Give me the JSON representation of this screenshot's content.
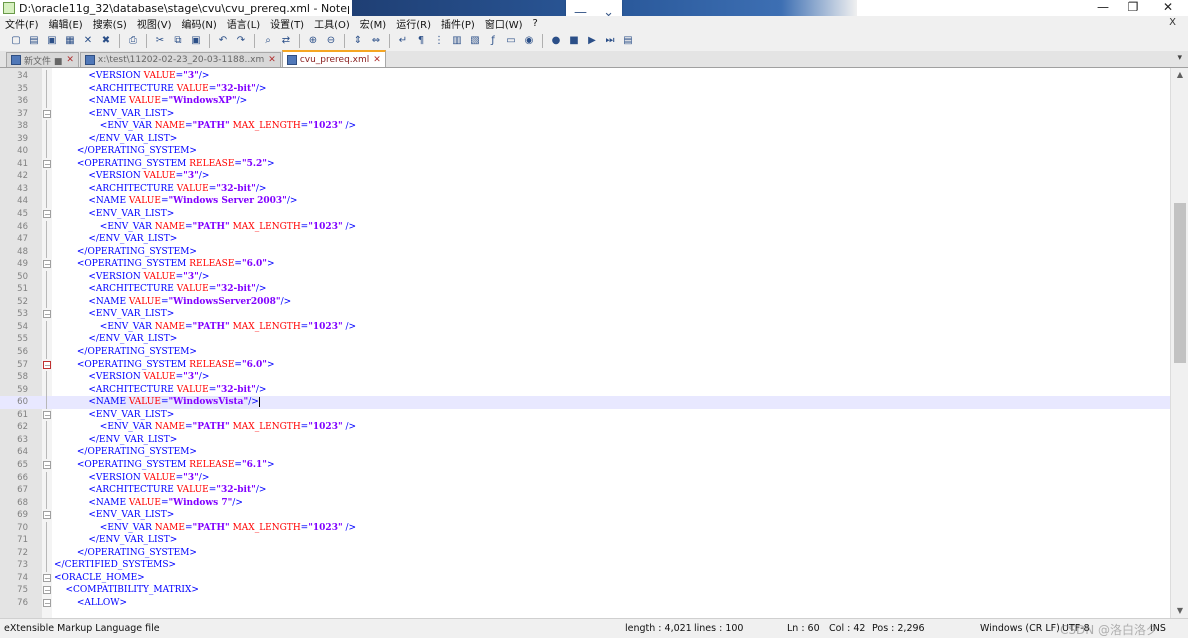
{
  "window": {
    "title": "D:\\oracle11g_32\\database\\stage\\cvu\\cvu_prereq.xml - Notepad++ [Admi",
    "minimize_glyph": "—",
    "maximize_glyph": "❐",
    "close_glyph": "✕",
    "overlay_minimize": "—",
    "overlay_chevron": "⌄"
  },
  "menu": {
    "items": [
      "文件(F)",
      "编辑(E)",
      "搜索(S)",
      "视图(V)",
      "编码(N)",
      "语言(L)",
      "设置(T)",
      "工具(O)",
      "宏(M)",
      "运行(R)",
      "插件(P)",
      "窗口(W)",
      "?"
    ],
    "close_x": "X"
  },
  "toolbar": {
    "icons": [
      "new-file-icon",
      "open-file-icon",
      "save-icon",
      "save-all-icon",
      "close-icon",
      "close-all-icon",
      "print-icon",
      "cut-icon",
      "copy-icon",
      "paste-icon",
      "undo-icon",
      "redo-icon",
      "find-icon",
      "replace-icon",
      "zoom-in-icon",
      "zoom-out-icon",
      "sync-v-icon",
      "sync-h-icon",
      "word-wrap-icon",
      "all-chars-icon",
      "indent-guide-icon",
      "udl-icon",
      "doc-map-icon",
      "function-list-icon",
      "folder-workspace-icon",
      "monitor-icon",
      "record-macro-icon",
      "stop-macro-icon",
      "play-macro-icon",
      "run-macro-multiple-icon",
      "save-macro-icon"
    ],
    "glyphs": [
      "▢",
      "▤",
      "▣",
      "▦",
      "✕",
      "✖",
      "⎙",
      "✂",
      "⧉",
      "▣",
      "↶",
      "↷",
      "⌕",
      "⇄",
      "⊕",
      "⊖",
      "⇕",
      "⇔",
      "↵",
      "¶",
      "⋮",
      "▥",
      "▧",
      "ƒ",
      "▭",
      "◉",
      "●",
      "■",
      "▶",
      "⏭",
      "▤"
    ]
  },
  "tabs": [
    {
      "label": "新文件 ■",
      "active": false
    },
    {
      "label": "x:\\test\\11202-02-23_20-03-1188..xm",
      "active": false
    },
    {
      "label": "cvu_prereq.xml",
      "active": true
    }
  ],
  "tab_close_glyph": "✕",
  "tab_list_glyph": "▾",
  "editor": {
    "current_line": 60,
    "lines": [
      {
        "n": "34",
        "fold": "line",
        "tokens": [
          [
            "i",
            "            "
          ],
          [
            "tag",
            "<VERSION "
          ],
          [
            "attr",
            "VALUE"
          ],
          [
            "tag",
            "="
          ],
          [
            "val",
            "\"3\""
          ],
          [
            "tag",
            "/>"
          ]
        ]
      },
      {
        "n": "35",
        "fold": "line",
        "tokens": [
          [
            "i",
            "            "
          ],
          [
            "tag",
            "<ARCHITECTURE "
          ],
          [
            "attr",
            "VALUE"
          ],
          [
            "tag",
            "="
          ],
          [
            "val",
            "\"32-bit\""
          ],
          [
            "tag",
            "/>"
          ]
        ]
      },
      {
        "n": "36",
        "fold": "line",
        "tokens": [
          [
            "i",
            "            "
          ],
          [
            "tag",
            "<NAME "
          ],
          [
            "attr",
            "VALUE"
          ],
          [
            "tag",
            "="
          ],
          [
            "val",
            "\"WindowsXP\""
          ],
          [
            "tag",
            "/>"
          ]
        ]
      },
      {
        "n": "37",
        "fold": "box",
        "tokens": [
          [
            "i",
            "            "
          ],
          [
            "tag",
            "<ENV_VAR_LIST>"
          ]
        ]
      },
      {
        "n": "38",
        "fold": "line",
        "tokens": [
          [
            "i",
            "                "
          ],
          [
            "tag",
            "<ENV_VAR "
          ],
          [
            "attr",
            "NAME"
          ],
          [
            "tag",
            "="
          ],
          [
            "val",
            "\"PATH\""
          ],
          [
            "tag",
            " "
          ],
          [
            "attr",
            "MAX_LENGTH"
          ],
          [
            "tag",
            "="
          ],
          [
            "val",
            "\"1023\""
          ],
          [
            "tag",
            " />"
          ]
        ]
      },
      {
        "n": "39",
        "fold": "line",
        "tokens": [
          [
            "i",
            "            "
          ],
          [
            "tag",
            "</ENV_VAR_LIST>"
          ]
        ]
      },
      {
        "n": "40",
        "fold": "line",
        "tokens": [
          [
            "i",
            "        "
          ],
          [
            "tag",
            "</OPERATING_SYSTEM>"
          ]
        ]
      },
      {
        "n": "41",
        "fold": "box",
        "tokens": [
          [
            "i",
            "        "
          ],
          [
            "tag",
            "<OPERATING_SYSTEM "
          ],
          [
            "attr",
            "RELEASE"
          ],
          [
            "tag",
            "="
          ],
          [
            "val",
            "\"5.2\""
          ],
          [
            "tag",
            ">"
          ]
        ]
      },
      {
        "n": "42",
        "fold": "line",
        "tokens": [
          [
            "i",
            "            "
          ],
          [
            "tag",
            "<VERSION "
          ],
          [
            "attr",
            "VALUE"
          ],
          [
            "tag",
            "="
          ],
          [
            "val",
            "\"3\""
          ],
          [
            "tag",
            "/>"
          ]
        ]
      },
      {
        "n": "43",
        "fold": "line",
        "tokens": [
          [
            "i",
            "            "
          ],
          [
            "tag",
            "<ARCHITECTURE "
          ],
          [
            "attr",
            "VALUE"
          ],
          [
            "tag",
            "="
          ],
          [
            "val",
            "\"32-bit\""
          ],
          [
            "tag",
            "/>"
          ]
        ]
      },
      {
        "n": "44",
        "fold": "line",
        "tokens": [
          [
            "i",
            "            "
          ],
          [
            "tag",
            "<NAME "
          ],
          [
            "attr",
            "VALUE"
          ],
          [
            "tag",
            "="
          ],
          [
            "val",
            "\"Windows Server 2003\""
          ],
          [
            "tag",
            "/>"
          ]
        ]
      },
      {
        "n": "45",
        "fold": "box",
        "tokens": [
          [
            "i",
            "            "
          ],
          [
            "tag",
            "<ENV_VAR_LIST>"
          ]
        ]
      },
      {
        "n": "46",
        "fold": "line",
        "tokens": [
          [
            "i",
            "                "
          ],
          [
            "tag",
            "<ENV_VAR "
          ],
          [
            "attr",
            "NAME"
          ],
          [
            "tag",
            "="
          ],
          [
            "val",
            "\"PATH\""
          ],
          [
            "tag",
            " "
          ],
          [
            "attr",
            "MAX_LENGTH"
          ],
          [
            "tag",
            "="
          ],
          [
            "val",
            "\"1023\""
          ],
          [
            "tag",
            " />"
          ]
        ]
      },
      {
        "n": "47",
        "fold": "line",
        "tokens": [
          [
            "i",
            "            "
          ],
          [
            "tag",
            "</ENV_VAR_LIST>"
          ]
        ]
      },
      {
        "n": "48",
        "fold": "line",
        "tokens": [
          [
            "i",
            "        "
          ],
          [
            "tag",
            "</OPERATING_SYSTEM>"
          ]
        ]
      },
      {
        "n": "49",
        "fold": "box",
        "tokens": [
          [
            "i",
            "        "
          ],
          [
            "tag",
            "<OPERATING_SYSTEM "
          ],
          [
            "attr",
            "RELEASE"
          ],
          [
            "tag",
            "="
          ],
          [
            "val",
            "\"6.0\""
          ],
          [
            "tag",
            ">"
          ]
        ]
      },
      {
        "n": "50",
        "fold": "line",
        "tokens": [
          [
            "i",
            "            "
          ],
          [
            "tag",
            "<VERSION "
          ],
          [
            "attr",
            "VALUE"
          ],
          [
            "tag",
            "="
          ],
          [
            "val",
            "\"3\""
          ],
          [
            "tag",
            "/>"
          ]
        ]
      },
      {
        "n": "51",
        "fold": "line",
        "tokens": [
          [
            "i",
            "            "
          ],
          [
            "tag",
            "<ARCHITECTURE "
          ],
          [
            "attr",
            "VALUE"
          ],
          [
            "tag",
            "="
          ],
          [
            "val",
            "\"32-bit\""
          ],
          [
            "tag",
            "/>"
          ]
        ]
      },
      {
        "n": "52",
        "fold": "line",
        "tokens": [
          [
            "i",
            "            "
          ],
          [
            "tag",
            "<NAME "
          ],
          [
            "attr",
            "VALUE"
          ],
          [
            "tag",
            "="
          ],
          [
            "val",
            "\"WindowsServer2008\""
          ],
          [
            "tag",
            "/>"
          ]
        ]
      },
      {
        "n": "53",
        "fold": "box",
        "tokens": [
          [
            "i",
            "            "
          ],
          [
            "tag",
            "<ENV_VAR_LIST>"
          ]
        ]
      },
      {
        "n": "54",
        "fold": "line",
        "tokens": [
          [
            "i",
            "                "
          ],
          [
            "tag",
            "<ENV_VAR "
          ],
          [
            "attr",
            "NAME"
          ],
          [
            "tag",
            "="
          ],
          [
            "val",
            "\"PATH\""
          ],
          [
            "tag",
            " "
          ],
          [
            "attr",
            "MAX_LENGTH"
          ],
          [
            "tag",
            "="
          ],
          [
            "val",
            "\"1023\""
          ],
          [
            "tag",
            " />"
          ]
        ]
      },
      {
        "n": "55",
        "fold": "line",
        "tokens": [
          [
            "i",
            "            "
          ],
          [
            "tag",
            "</ENV_VAR_LIST>"
          ]
        ]
      },
      {
        "n": "56",
        "fold": "line",
        "tokens": [
          [
            "i",
            "        "
          ],
          [
            "tag",
            "</OPERATING_SYSTEM>"
          ]
        ]
      },
      {
        "n": "57",
        "fold": "boxred",
        "tokens": [
          [
            "i",
            "        "
          ],
          [
            "tag",
            "<OPERATING_SYSTEM "
          ],
          [
            "attr",
            "RELEASE"
          ],
          [
            "tag",
            "="
          ],
          [
            "val",
            "\"6.0\""
          ],
          [
            "tag",
            ">"
          ]
        ]
      },
      {
        "n": "58",
        "fold": "line",
        "tokens": [
          [
            "i",
            "            "
          ],
          [
            "tag",
            "<VERSION "
          ],
          [
            "attr",
            "VALUE"
          ],
          [
            "tag",
            "="
          ],
          [
            "val",
            "\"3\""
          ],
          [
            "tag",
            "/>"
          ]
        ]
      },
      {
        "n": "59",
        "fold": "line",
        "tokens": [
          [
            "i",
            "            "
          ],
          [
            "tag",
            "<ARCHITECTURE "
          ],
          [
            "attr",
            "VALUE"
          ],
          [
            "tag",
            "="
          ],
          [
            "val",
            "\"32-bit\""
          ],
          [
            "tag",
            "/>"
          ]
        ]
      },
      {
        "n": "60",
        "fold": "line",
        "tokens": [
          [
            "i",
            "            "
          ],
          [
            "tag",
            "<NAME "
          ],
          [
            "attr",
            "VALUE"
          ],
          [
            "tag",
            "="
          ],
          [
            "val",
            "\"WindowsVista\""
          ],
          [
            "tag",
            "/>"
          ]
        ]
      },
      {
        "n": "61",
        "fold": "box",
        "tokens": [
          [
            "i",
            "            "
          ],
          [
            "tag",
            "<ENV_VAR_LIST>"
          ]
        ]
      },
      {
        "n": "62",
        "fold": "line",
        "tokens": [
          [
            "i",
            "                "
          ],
          [
            "tag",
            "<ENV_VAR "
          ],
          [
            "attr",
            "NAME"
          ],
          [
            "tag",
            "="
          ],
          [
            "val",
            "\"PATH\""
          ],
          [
            "tag",
            " "
          ],
          [
            "attr",
            "MAX_LENGTH"
          ],
          [
            "tag",
            "="
          ],
          [
            "val",
            "\"1023\""
          ],
          [
            "tag",
            " />"
          ]
        ]
      },
      {
        "n": "63",
        "fold": "line",
        "tokens": [
          [
            "i",
            "            "
          ],
          [
            "tag",
            "</ENV_VAR_LIST>"
          ]
        ]
      },
      {
        "n": "64",
        "fold": "line",
        "tokens": [
          [
            "i",
            "        "
          ],
          [
            "tag",
            "</OPERATING_SYSTEM>"
          ]
        ]
      },
      {
        "n": "65",
        "fold": "box",
        "tokens": [
          [
            "i",
            "        "
          ],
          [
            "tag",
            "<OPERATING_SYSTEM "
          ],
          [
            "attr",
            "RELEASE"
          ],
          [
            "tag",
            "="
          ],
          [
            "val",
            "\"6.1\""
          ],
          [
            "tag",
            ">"
          ]
        ]
      },
      {
        "n": "66",
        "fold": "line",
        "tokens": [
          [
            "i",
            "            "
          ],
          [
            "tag",
            "<VERSION "
          ],
          [
            "attr",
            "VALUE"
          ],
          [
            "tag",
            "="
          ],
          [
            "val",
            "\"3\""
          ],
          [
            "tag",
            "/>"
          ]
        ]
      },
      {
        "n": "67",
        "fold": "line",
        "tokens": [
          [
            "i",
            "            "
          ],
          [
            "tag",
            "<ARCHITECTURE "
          ],
          [
            "attr",
            "VALUE"
          ],
          [
            "tag",
            "="
          ],
          [
            "val",
            "\"32-bit\""
          ],
          [
            "tag",
            "/>"
          ]
        ]
      },
      {
        "n": "68",
        "fold": "line",
        "tokens": [
          [
            "i",
            "            "
          ],
          [
            "tag",
            "<NAME "
          ],
          [
            "attr",
            "VALUE"
          ],
          [
            "tag",
            "="
          ],
          [
            "val",
            "\"Windows 7\""
          ],
          [
            "tag",
            "/>"
          ]
        ]
      },
      {
        "n": "69",
        "fold": "box",
        "tokens": [
          [
            "i",
            "            "
          ],
          [
            "tag",
            "<ENV_VAR_LIST>"
          ]
        ]
      },
      {
        "n": "70",
        "fold": "line",
        "tokens": [
          [
            "i",
            "                "
          ],
          [
            "tag",
            "<ENV_VAR "
          ],
          [
            "attr",
            "NAME"
          ],
          [
            "tag",
            "="
          ],
          [
            "val",
            "\"PATH\""
          ],
          [
            "tag",
            " "
          ],
          [
            "attr",
            "MAX_LENGTH"
          ],
          [
            "tag",
            "="
          ],
          [
            "val",
            "\"1023\""
          ],
          [
            "tag",
            " />"
          ]
        ]
      },
      {
        "n": "71",
        "fold": "line",
        "tokens": [
          [
            "i",
            "            "
          ],
          [
            "tag",
            "</ENV_VAR_LIST>"
          ]
        ]
      },
      {
        "n": "72",
        "fold": "line",
        "tokens": [
          [
            "i",
            "        "
          ],
          [
            "tag",
            "</OPERATING_SYSTEM>"
          ]
        ]
      },
      {
        "n": "73",
        "fold": "line",
        "tokens": [
          [
            "i",
            ""
          ],
          [
            "tag",
            "</CERTIFIED_SYSTEMS>"
          ]
        ]
      },
      {
        "n": "74",
        "fold": "box",
        "tokens": [
          [
            "i",
            ""
          ],
          [
            "tag",
            "<ORACLE_HOME>"
          ]
        ]
      },
      {
        "n": "75",
        "fold": "box",
        "tokens": [
          [
            "i",
            "    "
          ],
          [
            "tag",
            "<COMPATIBILITY_MATRIX>"
          ]
        ]
      },
      {
        "n": "76",
        "fold": "box",
        "tokens": [
          [
            "i",
            "        "
          ],
          [
            "tag",
            "<ALLOW>"
          ]
        ]
      }
    ]
  },
  "scrollbar": {
    "up_glyph": "▲",
    "down_glyph": "▼"
  },
  "status": {
    "file_type": "eXtensible Markup Language file",
    "length": "length : 4,021",
    "lines": "lines : 100",
    "ln": "Ln : 60",
    "col": "Col : 42",
    "pos": "Pos : 2,296",
    "eol": "Windows (CR LF)",
    "encoding": "UTF-8",
    "mode": "INS"
  },
  "watermark": "CSDN @洛白洛夕",
  "colors": {
    "tag": "#0000ff",
    "attr": "#ff0000",
    "value": "#8000ff",
    "current_line": "#e8e8ff"
  }
}
